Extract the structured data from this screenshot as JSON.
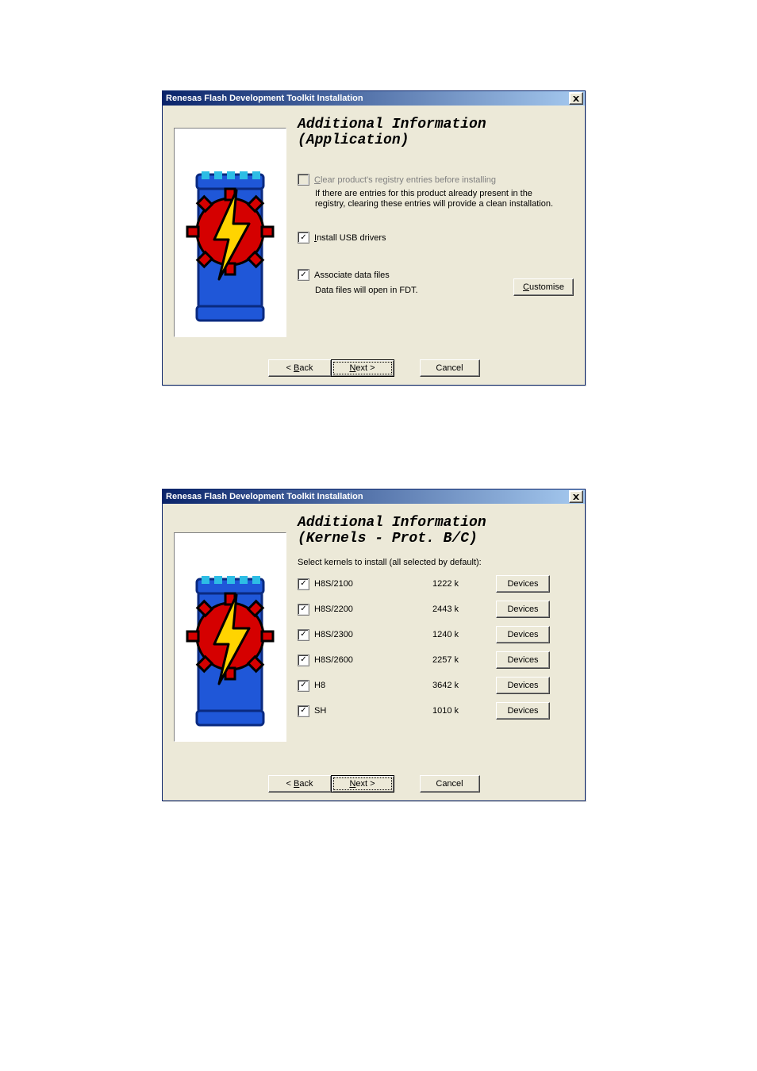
{
  "dialog1": {
    "title": "Renesas Flash Development Toolkit Installation",
    "heading1": "Additional Information",
    "heading2": "(Application)",
    "clear_registry": {
      "checked": false,
      "disabled": true,
      "label_pre": "C",
      "label_rest": "lear product's registry entries before installing",
      "help": "If there are entries for this product already present in the registry, clearing these entries will provide a clean installation."
    },
    "install_usb": {
      "checked": true,
      "label_pre": "I",
      "label_rest": "nstall USB drivers"
    },
    "assoc_files": {
      "checked": true,
      "label": "Associate data files",
      "help": "Data files will open in FDT."
    },
    "customise_pre": "C",
    "customise_rest": "ustomise",
    "back_pre": "< ",
    "back_ul": "B",
    "back_rest": "ack",
    "next_ul": "N",
    "next_rest": "ext >",
    "cancel": "Cancel"
  },
  "dialog2": {
    "title": "Renesas Flash Development Toolkit Installation",
    "heading1": "Additional Information",
    "heading2": "(Kernels - Prot. B/C)",
    "subhead": "Select kernels to install (all selected by default):",
    "devices_label": "Devices",
    "kernels": [
      {
        "name": "H8S/2100",
        "size": "1222 k"
      },
      {
        "name": "H8S/2200",
        "size": "2443 k"
      },
      {
        "name": "H8S/2300",
        "size": "1240 k"
      },
      {
        "name": "H8S/2600",
        "size": "2257 k"
      },
      {
        "name": "H8",
        "size": "3642 k"
      },
      {
        "name": "SH",
        "size": "1010 k"
      }
    ],
    "back_pre": "< ",
    "back_ul": "B",
    "back_rest": "ack",
    "next_ul": "N",
    "next_rest": "ext >",
    "cancel": "Cancel"
  }
}
